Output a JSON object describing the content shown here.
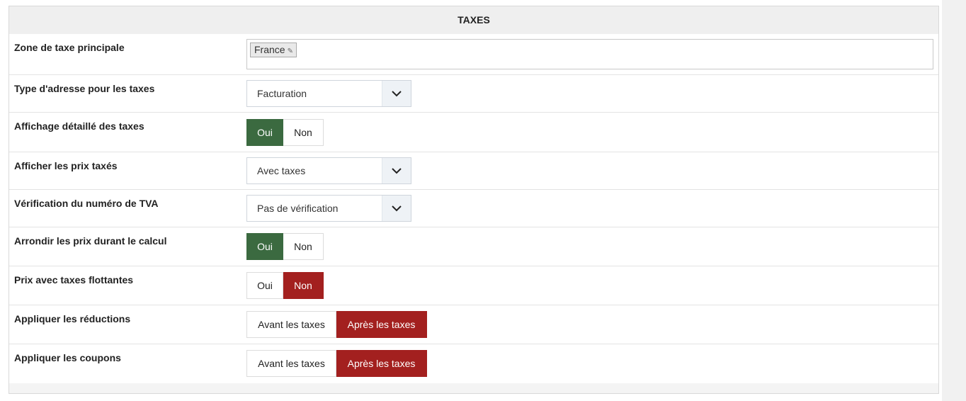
{
  "panel": {
    "title": "TAXES"
  },
  "rows": {
    "zone": {
      "label": "Zone de taxe principale",
      "tag": "France"
    },
    "address_type": {
      "label": "Type d'adresse pour les taxes",
      "value": "Facturation"
    },
    "detailed": {
      "label": "Affichage détaillé des taxes",
      "options": [
        "Oui",
        "Non"
      ],
      "selected": "Oui"
    },
    "show_prices": {
      "label": "Afficher les prix taxés",
      "value": "Avec taxes"
    },
    "vat_check": {
      "label": "Vérification du numéro de TVA",
      "value": "Pas de vérification"
    },
    "round": {
      "label": "Arrondir les prix durant le calcul",
      "options": [
        "Oui",
        "Non"
      ],
      "selected": "Oui"
    },
    "floating": {
      "label": "Prix avec taxes flottantes",
      "options": [
        "Oui",
        "Non"
      ],
      "selected": "Non"
    },
    "discounts": {
      "label": "Appliquer les réductions",
      "options": [
        "Avant les taxes",
        "Après les taxes"
      ],
      "selected": "Après les taxes"
    },
    "coupons": {
      "label": "Appliquer les coupons",
      "options": [
        "Avant les taxes",
        "Après les taxes"
      ],
      "selected": "Après les taxes"
    }
  },
  "icons": {
    "tag_edit": "pencil-icon",
    "select_arrow": "chevron-down-icon"
  },
  "colors": {
    "selected_yes": "#3b6a40",
    "selected_no": "#a3201f"
  }
}
